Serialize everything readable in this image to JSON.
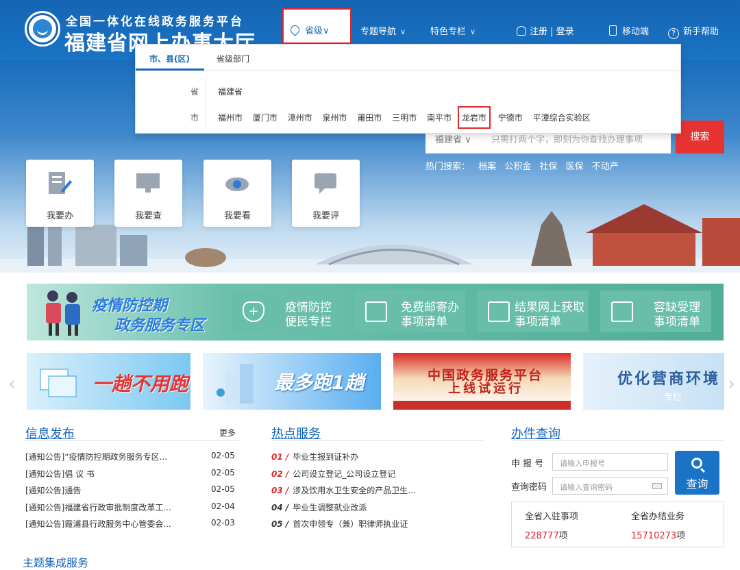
{
  "header": {
    "logo_sub": "全国一体化在线政务服务平台",
    "logo_main": "福建省网上办事大厅",
    "nav": {
      "province": "省级",
      "topics": "专题导航",
      "features": "特色专栏",
      "login": "注册 | 登录",
      "mobile": "移动端",
      "help": "新手帮助"
    }
  },
  "dropdown": {
    "tabs": [
      "市、县(区)",
      "省级部门"
    ],
    "province_label": "省",
    "province_value": "福建省",
    "city_label": "市",
    "cities": [
      "福州市",
      "厦门市",
      "漳州市",
      "泉州市",
      "莆田市",
      "三明市",
      "南平市",
      "龙岩市",
      "宁德市",
      "平潭综合实验区"
    ],
    "highlighted_city": "龙岩市"
  },
  "services": [
    "我要办",
    "我要查",
    "我要看",
    "我要评"
  ],
  "search": {
    "scope": "福建省 ∨",
    "placeholder": "只需打两个字，即刻为你查找办理事项",
    "button": "搜索",
    "hot_label": "热门搜索：",
    "hot_terms": [
      "档案",
      "公积金",
      "社保",
      "医保",
      "不动产"
    ]
  },
  "epidemic": {
    "title_line1": "疫情防控期",
    "title_line2": "政务服务专区",
    "items": [
      {
        "l1": "疫情防控",
        "l2": "便民专栏",
        "icon": "shield-plus-icon"
      },
      {
        "l1": "免费邮寄办",
        "l2": "事项清单",
        "icon": "envelope-icon"
      },
      {
        "l1": "结果网上获取",
        "l2": "事项清单",
        "icon": "monitor-icon"
      },
      {
        "l1": "容缺受理",
        "l2": "事项清单",
        "icon": "document-clock-icon"
      }
    ]
  },
  "carousel": {
    "slide1": "一趟不用跑",
    "slide2": "最多跑1趟",
    "slide3_l1": "中国政务服务平台",
    "slide3_l2": "上线试运行",
    "slide4": "优化营商环境",
    "slide4_sub": "专栏"
  },
  "news": {
    "title": "信息发布",
    "more": "更多",
    "items": [
      {
        "title": "[通知公告]“疫情防控期政务服务专区...",
        "date": "02-05"
      },
      {
        "title": "[通知公告]倡 议 书",
        "date": "02-05"
      },
      {
        "title": "[通知公告]通告",
        "date": "02-05"
      },
      {
        "title": "[通知公告]福建省行政审批制度改革工...",
        "date": "02-04"
      },
      {
        "title": "[通知公告]霞浦县行政服务中心管委会...",
        "date": "02-03"
      }
    ]
  },
  "hot_services": {
    "title": "热点服务",
    "items": [
      {
        "no": "01 /",
        "text": "毕业生报到证补办"
      },
      {
        "no": "02 /",
        "text": "公司设立登记_公司设立登记"
      },
      {
        "no": "03 /",
        "text": "涉及饮用水卫生安全的产品卫生..."
      },
      {
        "no": "04 /",
        "text": "毕业生调整就业改派"
      },
      {
        "no": "05 /",
        "text": "首次申领专（兼）职律师执业证"
      }
    ]
  },
  "query": {
    "title": "办件查询",
    "apply_label": "申 报 号",
    "apply_placeholder": "请输入申报号",
    "pwd_label": "查询密码",
    "pwd_placeholder": "请输入查询密码",
    "button": "查询",
    "stat1_label": "全省入驻事项",
    "stat1_value": "228777",
    "stat1_unit": "项",
    "stat2_label": "全省办结业务",
    "stat2_value": "15710273",
    "stat2_unit": "项"
  },
  "theme": {
    "title": "主题集成服务"
  },
  "colors": {
    "brand_blue": "#1a73c4",
    "accent_red": "#e0262e",
    "teal": "#4fae98"
  }
}
